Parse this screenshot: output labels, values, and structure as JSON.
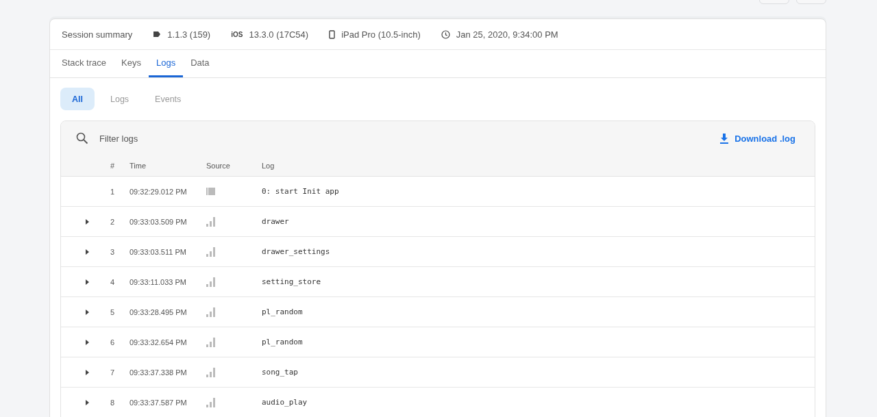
{
  "session_summary": {
    "title": "Session summary",
    "version": "1.1.3 (159)",
    "os_label": "iOS",
    "os_version": "13.3.0 (17C54)",
    "device": "iPad Pro (10.5-inch)",
    "date": "Jan 25, 2020, 9:34:00 PM"
  },
  "tabs": [
    {
      "label": "Stack trace",
      "selected": false
    },
    {
      "label": "Keys",
      "selected": false
    },
    {
      "label": "Logs",
      "selected": true
    },
    {
      "label": "Data",
      "selected": false
    }
  ],
  "filters": [
    {
      "label": "All",
      "selected": true
    },
    {
      "label": "Logs",
      "selected": false
    },
    {
      "label": "Events",
      "selected": false
    }
  ],
  "search": {
    "placeholder": "Filter logs"
  },
  "download_button": "Download .log",
  "table": {
    "columns": [
      "#",
      "Time",
      "Source",
      "Log"
    ],
    "rows": [
      {
        "kind": "block",
        "expandable": false,
        "number": "1",
        "time": "09:32:29.012 PM",
        "log": "0: start Init app"
      },
      {
        "kind": "bars",
        "expandable": true,
        "number": "2",
        "time": "09:33:03.509 PM",
        "log": "drawer"
      },
      {
        "kind": "bars",
        "expandable": true,
        "number": "3",
        "time": "09:33:03.511 PM",
        "log": "drawer_settings"
      },
      {
        "kind": "bars",
        "expandable": true,
        "number": "4",
        "time": "09:33:11.033 PM",
        "log": "setting_store"
      },
      {
        "kind": "bars",
        "expandable": true,
        "number": "5",
        "time": "09:33:28.495 PM",
        "log": "pl_random"
      },
      {
        "kind": "bars",
        "expandable": true,
        "number": "6",
        "time": "09:33:32.654 PM",
        "log": "pl_random"
      },
      {
        "kind": "bars",
        "expandable": true,
        "number": "7",
        "time": "09:33:37.338 PM",
        "log": "song_tap"
      },
      {
        "kind": "bars",
        "expandable": true,
        "number": "8",
        "time": "09:33:37.587 PM",
        "log": "audio_play"
      }
    ]
  }
}
